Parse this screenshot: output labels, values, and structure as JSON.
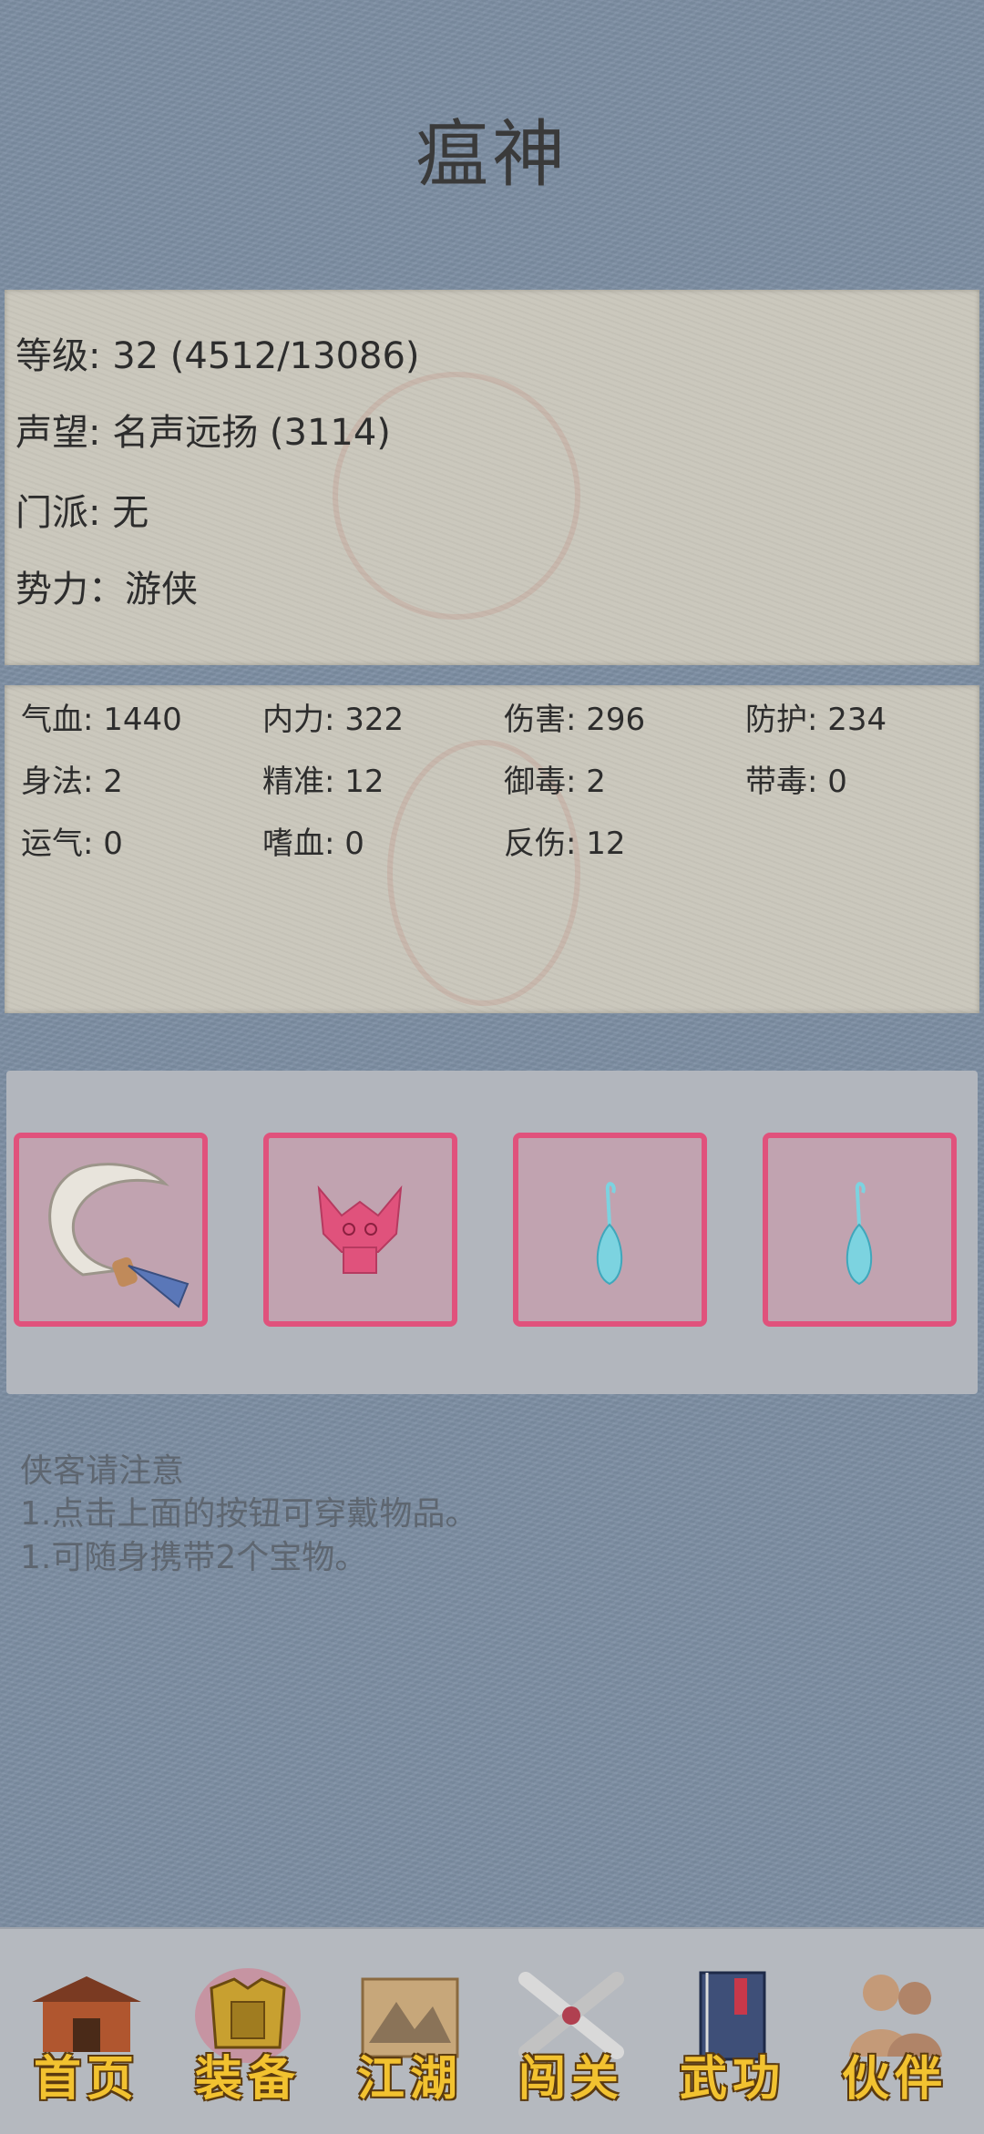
{
  "title": "瘟神",
  "info": {
    "level": "等级: 32 (4512/13086)",
    "fame": "声望: 名声远扬 (3114)",
    "sect": "门派: 无",
    "faction": "势力：游侠"
  },
  "stats": [
    [
      "气血: 1440",
      "内力: 322",
      "伤害: 296",
      "防护: 234"
    ],
    [
      "身法: 2",
      "精准: 12",
      "御毒: 2",
      "带毒: 0"
    ],
    [
      "运气: 0",
      "嗜血: 0",
      "反伤: 12"
    ]
  ],
  "equipment": {
    "slots": [
      {
        "icon": "hook-blade-icon"
      },
      {
        "icon": "demon-mask-icon"
      },
      {
        "icon": "water-drop-pendant-icon"
      },
      {
        "icon": "water-drop-pendant-icon"
      }
    ],
    "slot_border_color": "#e0527c"
  },
  "notice": {
    "heading": "侠客请注意",
    "line1": "1.点击上面的按钮可穿戴物品。",
    "line2": "1.可随身携带2个宝物。"
  },
  "nav": [
    {
      "label": "首页",
      "icon": "house-icon"
    },
    {
      "label": "装备",
      "icon": "armor-icon"
    },
    {
      "label": "江湖",
      "icon": "scroll-map-icon"
    },
    {
      "label": "闯关",
      "icon": "crossed-swords-icon"
    },
    {
      "label": "武功",
      "icon": "book-icon"
    },
    {
      "label": "伙伴",
      "icon": "companions-icon"
    }
  ],
  "colors": {
    "background": "#7d8ea3",
    "nav_text": "#f2c230"
  }
}
